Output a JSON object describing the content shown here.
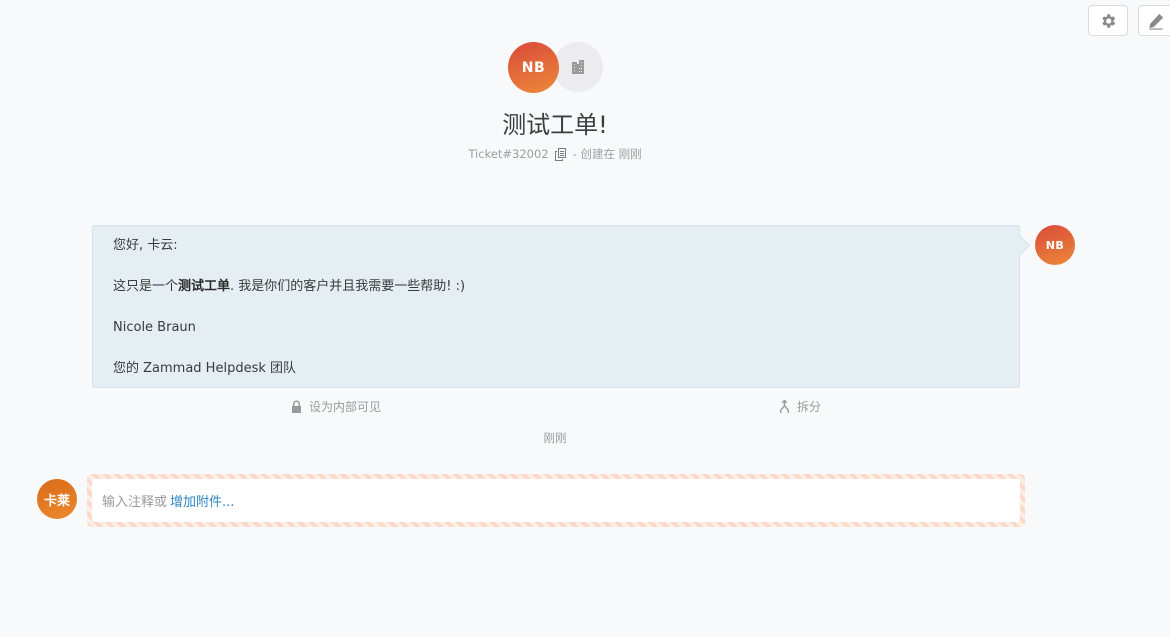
{
  "toolbar": {
    "settings_icon": "gear-icon",
    "edit_icon": "pencil-icon"
  },
  "header": {
    "customer_initials": "NB",
    "organization_icon": "building-icon",
    "title": "测试工单!",
    "ticket_number": "Ticket#32002",
    "copy_icon": "copy-icon",
    "created_text": "- 创建在 刚刚"
  },
  "article": {
    "greeting": "您好, 卡云:",
    "body_prefix": "这只是一个",
    "body_bold": "测试工单",
    "body_suffix": ". 我是你们的客户并且我需要一些帮助! :)",
    "signature_name": "Nicole Braun",
    "signature_team": "您的 Zammad Helpdesk 团队",
    "author_initials": "NB",
    "actions": {
      "internal_label": "设为内部可见",
      "split_label": "拆分"
    },
    "timestamp": "刚刚"
  },
  "reply": {
    "user_initials": "卡莱",
    "placeholder": "输入注释或",
    "attachment_link": "增加附件..."
  },
  "colors": {
    "avatar_gradient_start": "#d9493b",
    "avatar_gradient_end": "#ec8a39",
    "article_bg": "#e4eef3",
    "link": "#2f85c4"
  }
}
